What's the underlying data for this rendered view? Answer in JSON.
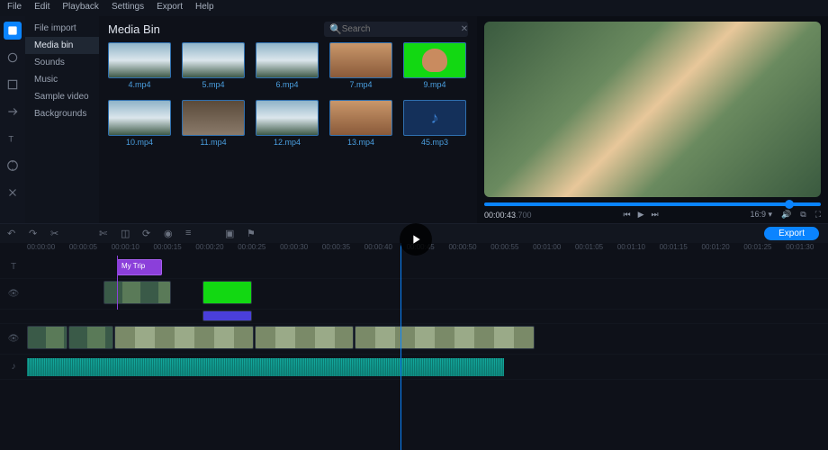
{
  "menu": {
    "items": [
      "File",
      "Edit",
      "Playback",
      "Settings",
      "Export",
      "Help"
    ]
  },
  "tools": [
    {
      "name": "import",
      "active": true
    },
    {
      "name": "filters"
    },
    {
      "name": "titles"
    },
    {
      "name": "transitions"
    },
    {
      "name": "text"
    },
    {
      "name": "stabilize"
    },
    {
      "name": "more"
    }
  ],
  "sidenav": {
    "items": [
      "File import",
      "Media bin",
      "Sounds",
      "Music",
      "Sample video",
      "Backgrounds"
    ],
    "selected": 1
  },
  "bin": {
    "title": "Media Bin",
    "search_placeholder": "Search",
    "clips": [
      {
        "label": "4.mp4",
        "kind": "mtn"
      },
      {
        "label": "5.mp4",
        "kind": "mtn"
      },
      {
        "label": "6.mp4",
        "kind": "mtn"
      },
      {
        "label": "7.mp4",
        "kind": "dun"
      },
      {
        "label": "9.mp4",
        "kind": "grn"
      },
      {
        "label": "10.mp4",
        "kind": "mtn"
      },
      {
        "label": "11.mp4",
        "kind": "ppl"
      },
      {
        "label": "12.mp4",
        "kind": "mtn"
      },
      {
        "label": "13.mp4",
        "kind": "dun"
      },
      {
        "label": "45.mp3",
        "kind": "mus"
      }
    ]
  },
  "preview": {
    "timecode": "00:00:43",
    "frames": ".700",
    "ratio": "16:9"
  },
  "toolbar": {
    "export_label": "Export"
  },
  "ruler": {
    "marks": [
      "00:00:00",
      "00:00:05",
      "00:00:10",
      "00:00:15",
      "00:00:20",
      "00:00:25",
      "00:00:30",
      "00:00:35",
      "00:00:40",
      "00:00:45",
      "00:00:50",
      "00:00:55",
      "00:01:00",
      "00:01:05",
      "00:01:10",
      "00:01:15",
      "00:01:20",
      "00:01:25",
      "00:01:30"
    ]
  },
  "timeline": {
    "title_clip": {
      "label": "My Trip"
    }
  }
}
